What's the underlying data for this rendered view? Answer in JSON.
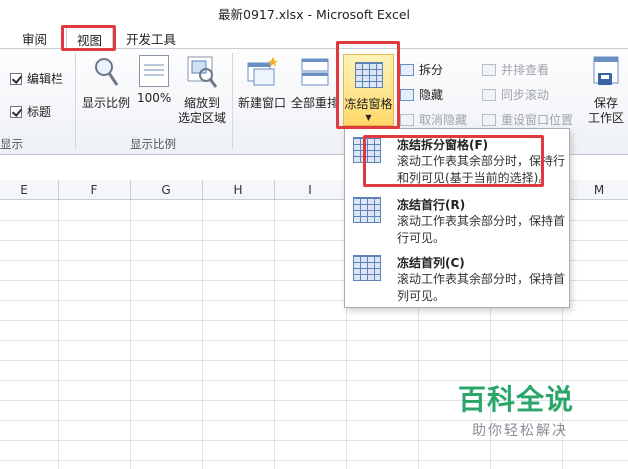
{
  "window": {
    "title": "最新0917.xlsx  -  Microsoft Excel"
  },
  "tabs": {
    "review": "审阅",
    "view": "视图",
    "developer": "开发工具"
  },
  "ribbon": {
    "show_group": {
      "formula_bar": "编辑栏",
      "formula_bar_checked": true,
      "headings": "标题",
      "headings_checked": true,
      "label": "显示"
    },
    "zoom_group": {
      "zoom": "显示比例",
      "zoom100": "100%",
      "zoom_sel_line1": "缩放到",
      "zoom_sel_line2": "选定区域",
      "label": "显示比例"
    },
    "window_group": {
      "new_window": "新建窗口",
      "arrange_all": "全部重排",
      "freeze_panes": "冻结窗格",
      "split": "拆分",
      "hide": "隐藏",
      "unhide": "取消隐藏",
      "view_side_by_side": "并排查看",
      "sync_scroll": "同步滚动",
      "reset_position": "重设窗口位置",
      "save_workspace_line1": "保存",
      "save_workspace_line2": "工作区"
    }
  },
  "freeze_menu": {
    "items": [
      {
        "title": "冻结拆分窗格(F)",
        "desc": "滚动工作表其余部分时，保持行和列可见(基于当前的选择)。"
      },
      {
        "title": "冻结首行(R)",
        "desc": "滚动工作表其余部分时，保持首行可见。"
      },
      {
        "title": "冻结首列(C)",
        "desc": "滚动工作表其余部分时，保持首列可见。"
      }
    ]
  },
  "columns": [
    "E",
    "F",
    "G",
    "H",
    "I",
    "M"
  ],
  "watermark": {
    "brand": "百科全说",
    "slogan": "助你轻松解决"
  },
  "colors": {
    "highlight": "#e0393e",
    "freeze_active": "#ffd86b",
    "watermark": "#2aa66b"
  }
}
